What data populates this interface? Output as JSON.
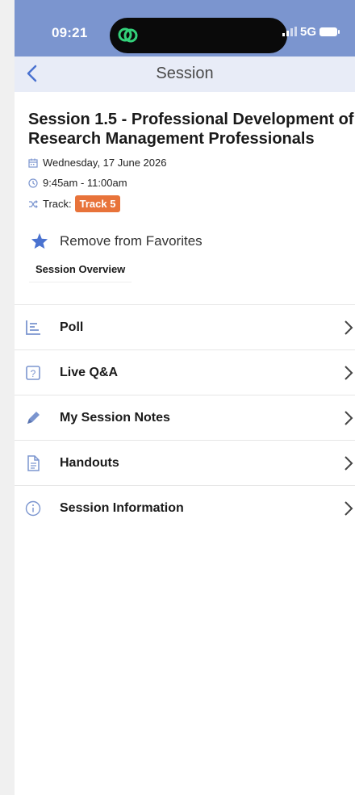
{
  "status_bar": {
    "time": "09:21",
    "network": "5G",
    "island_icon": "link-chain-icon",
    "bg_color": "#7b95cf"
  },
  "nav": {
    "title": "Session",
    "back_icon": "chevron-left-icon"
  },
  "session": {
    "title_line1": "Session 1.5 - Professional Development of",
    "title_line2": "Research Management Professionals",
    "date": "Wednesday, 17 June 2026",
    "time": "9:45am - 11:00am",
    "track_label": "Track:",
    "track_value": "Track 5",
    "track_color": "#e8733a",
    "favorite_label": "Remove from Favorites",
    "favorite_icon": "star-icon",
    "favorite_color": "#4a72d0"
  },
  "tabs": {
    "overview": "Session Overview"
  },
  "menu": {
    "items": [
      {
        "label": "Poll",
        "icon": "poll-chart-icon"
      },
      {
        "label": "Live Q&A",
        "icon": "question-box-icon"
      },
      {
        "label": "My Session Notes",
        "icon": "pencil-icon"
      },
      {
        "label": "Handouts",
        "icon": "document-icon"
      },
      {
        "label": "Session Information",
        "icon": "info-icon"
      }
    ],
    "icon_color": "#7b95cf"
  }
}
